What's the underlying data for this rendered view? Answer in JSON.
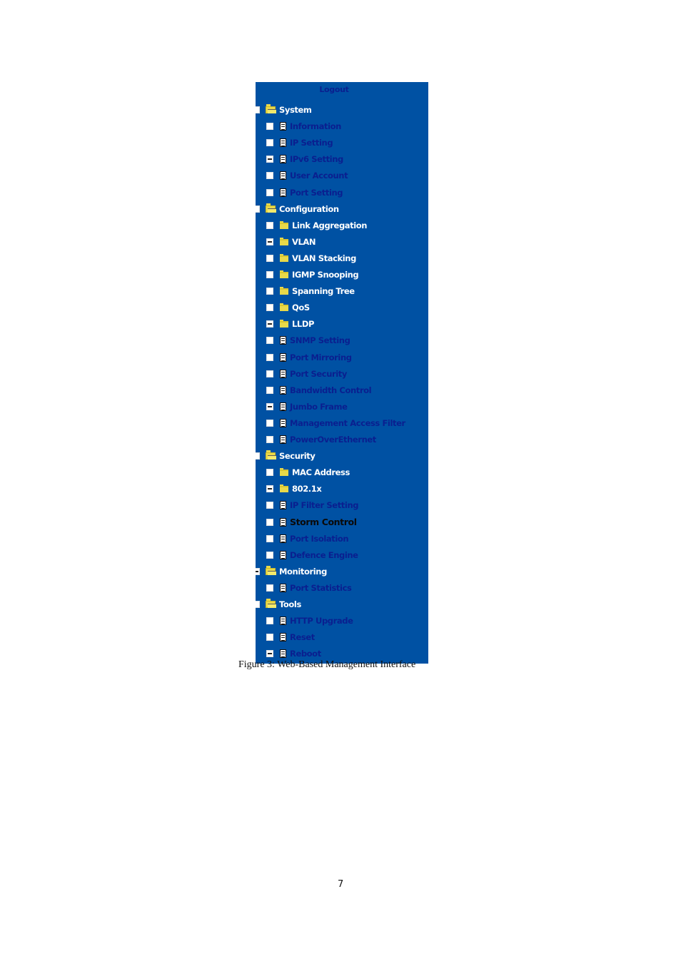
{
  "nav": {
    "logout_label": "Logout",
    "colors": {
      "panel_bg": "#0051a3",
      "link_text": "#0a1f8f",
      "section_text": "#ffffff",
      "active_text": "#0a0a0a",
      "folder": "#e8d84a"
    },
    "sections": [
      {
        "label": "System",
        "icon": "open-folder-icon",
        "items": [
          {
            "label": "Information",
            "icon": "document-icon",
            "style": "link",
            "expanded_marker": false
          },
          {
            "label": "IP Setting",
            "icon": "document-icon",
            "style": "link",
            "expanded_marker": false
          },
          {
            "label": "IPv6 Setting",
            "icon": "document-icon",
            "style": "link",
            "expanded_marker": true
          },
          {
            "label": "User Account",
            "icon": "document-icon",
            "style": "link",
            "expanded_marker": false
          },
          {
            "label": "Port Setting",
            "icon": "document-icon",
            "style": "link",
            "expanded_marker": false
          }
        ]
      },
      {
        "label": "Configuration",
        "icon": "open-folder-icon",
        "items": [
          {
            "label": "Link Aggregation",
            "icon": "folder-icon",
            "style": "folder",
            "expanded_marker": false
          },
          {
            "label": "VLAN",
            "icon": "folder-icon",
            "style": "folder",
            "expanded_marker": true
          },
          {
            "label": "VLAN Stacking",
            "icon": "folder-icon",
            "style": "folder",
            "expanded_marker": false
          },
          {
            "label": "IGMP Snooping",
            "icon": "folder-icon",
            "style": "folder",
            "expanded_marker": false
          },
          {
            "label": "Spanning Tree",
            "icon": "folder-icon",
            "style": "folder",
            "expanded_marker": false
          },
          {
            "label": "QoS",
            "icon": "folder-icon",
            "style": "folder",
            "expanded_marker": false
          },
          {
            "label": "LLDP",
            "icon": "folder-icon",
            "style": "folder",
            "expanded_marker": true
          },
          {
            "label": "SNMP Setting",
            "icon": "document-icon",
            "style": "link",
            "expanded_marker": false
          },
          {
            "label": "Port Mirroring",
            "icon": "document-icon",
            "style": "link",
            "expanded_marker": false
          },
          {
            "label": "Port Security",
            "icon": "document-icon",
            "style": "link",
            "expanded_marker": false
          },
          {
            "label": "Bandwidth Control",
            "icon": "document-icon",
            "style": "link",
            "expanded_marker": false
          },
          {
            "label": "Jumbo Frame",
            "icon": "document-icon",
            "style": "link",
            "expanded_marker": true
          },
          {
            "label": "Management Access  Filter",
            "icon": "document-icon",
            "style": "link",
            "expanded_marker": false
          },
          {
            "label": "PowerOverEthernet",
            "icon": "document-icon",
            "style": "link",
            "expanded_marker": false
          }
        ]
      },
      {
        "label": "Security",
        "icon": "open-folder-icon",
        "items": [
          {
            "label": "MAC Address",
            "icon": "folder-icon",
            "style": "folder",
            "expanded_marker": false
          },
          {
            "label": "802.1x",
            "icon": "folder-icon",
            "style": "folder",
            "expanded_marker": true
          },
          {
            "label": "IP Filter Setting",
            "icon": "document-icon",
            "style": "link",
            "expanded_marker": false
          },
          {
            "label": "Storm Control",
            "icon": "document-icon",
            "style": "active",
            "expanded_marker": false
          },
          {
            "label": "Port Isolation",
            "icon": "document-icon",
            "style": "link",
            "expanded_marker": false
          },
          {
            "label": "Defence Engine",
            "icon": "document-icon",
            "style": "link",
            "expanded_marker": false
          }
        ]
      },
      {
        "label": "Monitoring",
        "icon": "open-folder-icon",
        "expanded_marker": true,
        "items": [
          {
            "label": "Port Statistics",
            "icon": "document-icon",
            "style": "link",
            "expanded_marker": false
          }
        ]
      },
      {
        "label": "Tools",
        "icon": "open-folder-icon",
        "items": [
          {
            "label": "HTTP Upgrade",
            "icon": "document-icon",
            "style": "link",
            "expanded_marker": false
          },
          {
            "label": "Reset",
            "icon": "document-icon",
            "style": "link",
            "expanded_marker": false
          },
          {
            "label": "Reboot",
            "icon": "document-icon",
            "style": "link",
            "expanded_marker": true
          }
        ]
      }
    ]
  },
  "document": {
    "caption": "Figure 3: Web-Based Management Interface",
    "page_number": "7"
  }
}
